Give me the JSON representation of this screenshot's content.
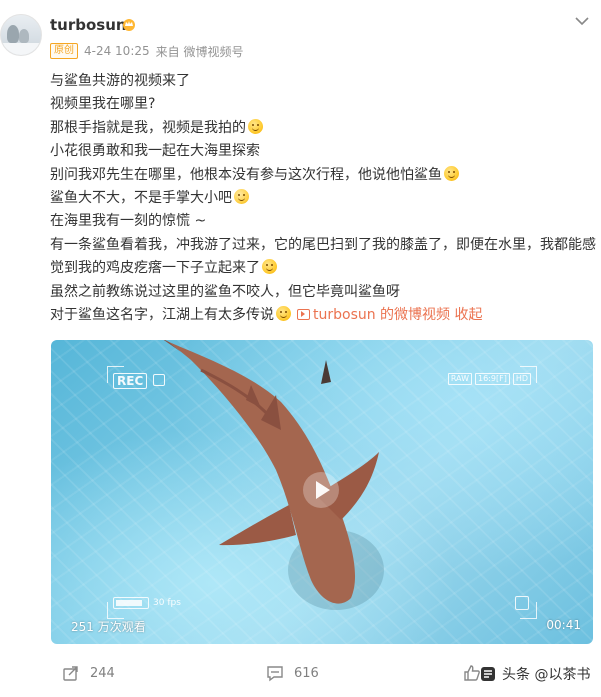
{
  "author": {
    "name": "turbosun",
    "crown_icon": "crown-icon"
  },
  "meta": {
    "badge": "原创",
    "timestamp": "4-24 10:25",
    "source": "来自 微博视频号"
  },
  "content_lines": [
    "与鲨鱼共游的视频来了",
    "视频里我在哪里?",
    "那根手指就是我，视频是我拍的",
    "小花很勇敢和我一起在大海里探索",
    "别问我邓先生在哪里，他根本没有参与这次行程，他说他怕鲨鱼",
    "鲨鱼大不大，不是手掌大小吧",
    "在海里我有一刻的惊慌 ~",
    "有一条鲨鱼看着我，冲我游了过来，它的尾巴扫到了我的膝盖了，即便在水里，我都能感觉到我的鸡皮疙瘩一下子立起来了",
    "虽然之前教练说过这里的鲨鱼不咬人，但它毕竟叫鲨鱼呀",
    "对于鲨鱼这名字，江湖上有太多传说"
  ],
  "video_link": {
    "label": "turbosun 的微博视频",
    "collapse": "收起"
  },
  "video": {
    "rec": "REC",
    "raw_tags": [
      "RAW",
      "16:9[F]",
      "HD"
    ],
    "fps": "30 fps",
    "views": "251 万次观看",
    "duration": "00:41"
  },
  "actions": {
    "share_count": "244",
    "comment_count": "616"
  },
  "watermark": "头条 @以茶书",
  "colors": {
    "accent": "#eb7350",
    "text": "#333333",
    "muted": "#939393"
  }
}
